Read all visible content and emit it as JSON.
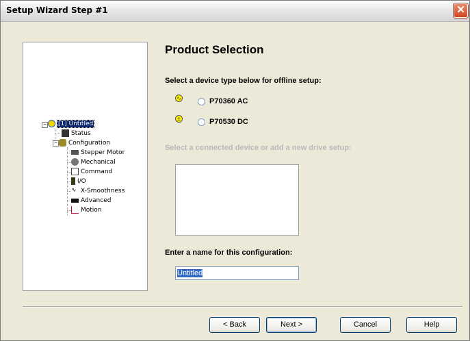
{
  "window": {
    "title": "Setup Wizard Step #1",
    "close_label": "✕"
  },
  "tree": {
    "root": "[1] Untitled",
    "status": "Status",
    "configuration": "Configuration",
    "children": [
      "Stepper Motor",
      "Mechanical",
      "Command",
      "I/O",
      "X-Smoothness",
      "Advanced",
      "Motion"
    ]
  },
  "main": {
    "heading": "Product Selection",
    "device_prompt": "Select a device type below for offline setup:",
    "devices": [
      {
        "label": "P70360 AC",
        "icon": "ac-wave-icon",
        "icon_glyph": "∿"
      },
      {
        "label": "P70530 DC",
        "icon": "dc-plus-icon",
        "icon_glyph": "±"
      }
    ],
    "connected_prompt": "Select a connected device or add a new drive setup:",
    "name_prompt": "Enter a name for this configuration:",
    "name_value": "Untitled"
  },
  "buttons": {
    "back": "< Back",
    "next": "Next >",
    "cancel": "Cancel",
    "help": "Help"
  },
  "colors": {
    "selection": "#0a246a",
    "device_icon": "#ffee00",
    "disabled_text": "#b8b8b8"
  }
}
